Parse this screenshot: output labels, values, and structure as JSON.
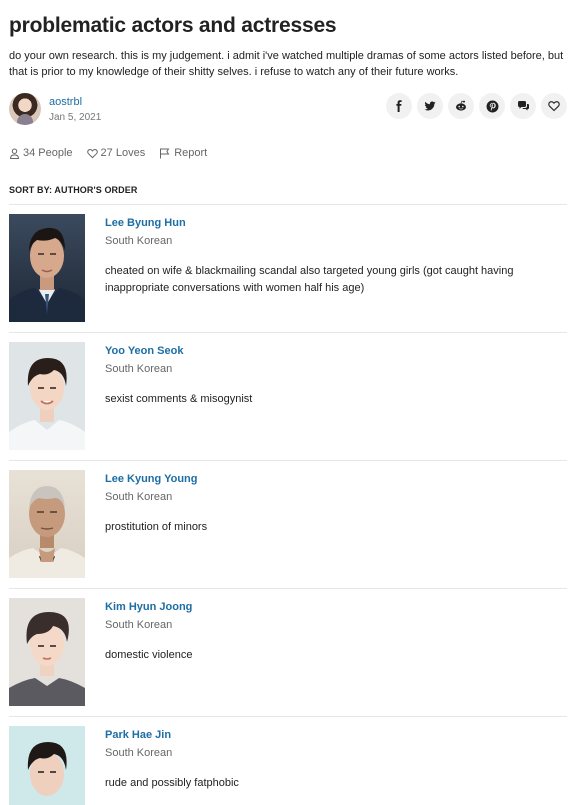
{
  "list": {
    "title": "problematic actors and actresses",
    "description": "do your own research. this is my judgement. i admit i've watched multiple dramas of some actors listed before, but that is prior to my knowledge of their shitty selves. i refuse to watch any of their future works.",
    "author": "aostrbl",
    "date": "Jan 5, 2021"
  },
  "share_icons": [
    "facebook-icon",
    "twitter-icon",
    "reddit-icon",
    "pinterest-icon",
    "comments-icon",
    "heart-icon"
  ],
  "stats": {
    "people": "34 People",
    "loves": "27 Loves",
    "report": "Report"
  },
  "sort_label": "SORT BY: AUTHOR'S ORDER",
  "colors": {
    "link": "#1c6ea4",
    "divider": "#e6e6e6",
    "icon_bg": "#f1f1f1"
  },
  "entries": [
    {
      "name": "Lee Byung Hun",
      "nationality": "South Korean",
      "note": "cheated on wife & blackmailing scandal also targeted young girls (got caught having inappropriate conversations with women half his age)"
    },
    {
      "name": "Yoo Yeon Seok",
      "nationality": "South Korean",
      "note": "sexist comments & misogynist"
    },
    {
      "name": "Lee Kyung Young",
      "nationality": "South Korean",
      "note": "prostitution of minors"
    },
    {
      "name": "Kim Hyun Joong",
      "nationality": "South Korean",
      "note": "domestic violence"
    },
    {
      "name": "Park Hae Jin",
      "nationality": "South Korean",
      "note": "rude and possibly fatphobic"
    }
  ]
}
